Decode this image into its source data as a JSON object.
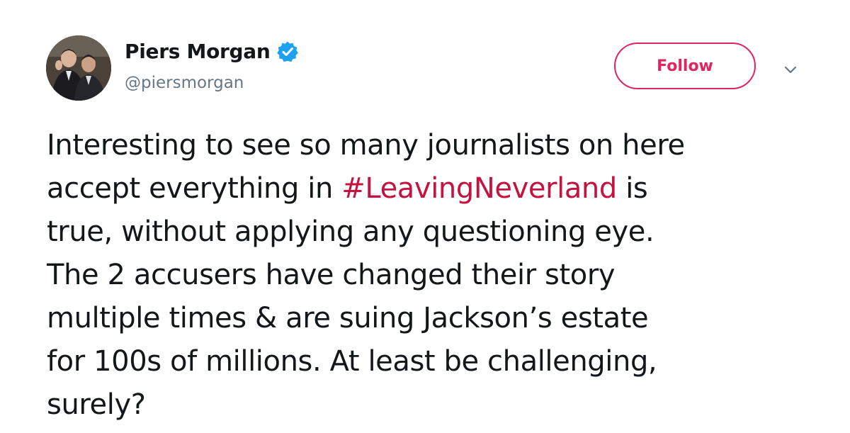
{
  "author": {
    "display_name": "Piers Morgan",
    "handle": "@piersmorgan",
    "verified": true
  },
  "actions": {
    "follow_label": "Follow"
  },
  "icons": {
    "verified": "verified-badge-icon",
    "menu": "chevron-down-icon"
  },
  "colors": {
    "accent": "#e0245e",
    "hashtag": "#c5123f",
    "verified": "#1da1f2",
    "secondary_text": "#657786",
    "text": "#14171a"
  },
  "tweet": {
    "lines": [
      {
        "text": "Interesting to see so many journalists on here"
      },
      {
        "before": "accept everything in ",
        "hashtag": "#LeavingNeverland",
        "after": " is"
      },
      {
        "text": "true, without applying any questioning eye."
      },
      {
        "text": "The 2 accusers have changed their story"
      },
      {
        "text": "multiple times & are suing Jackson’s estate"
      },
      {
        "text": "for 100s of millions. At least be challenging,"
      },
      {
        "text": "surely?"
      }
    ]
  }
}
